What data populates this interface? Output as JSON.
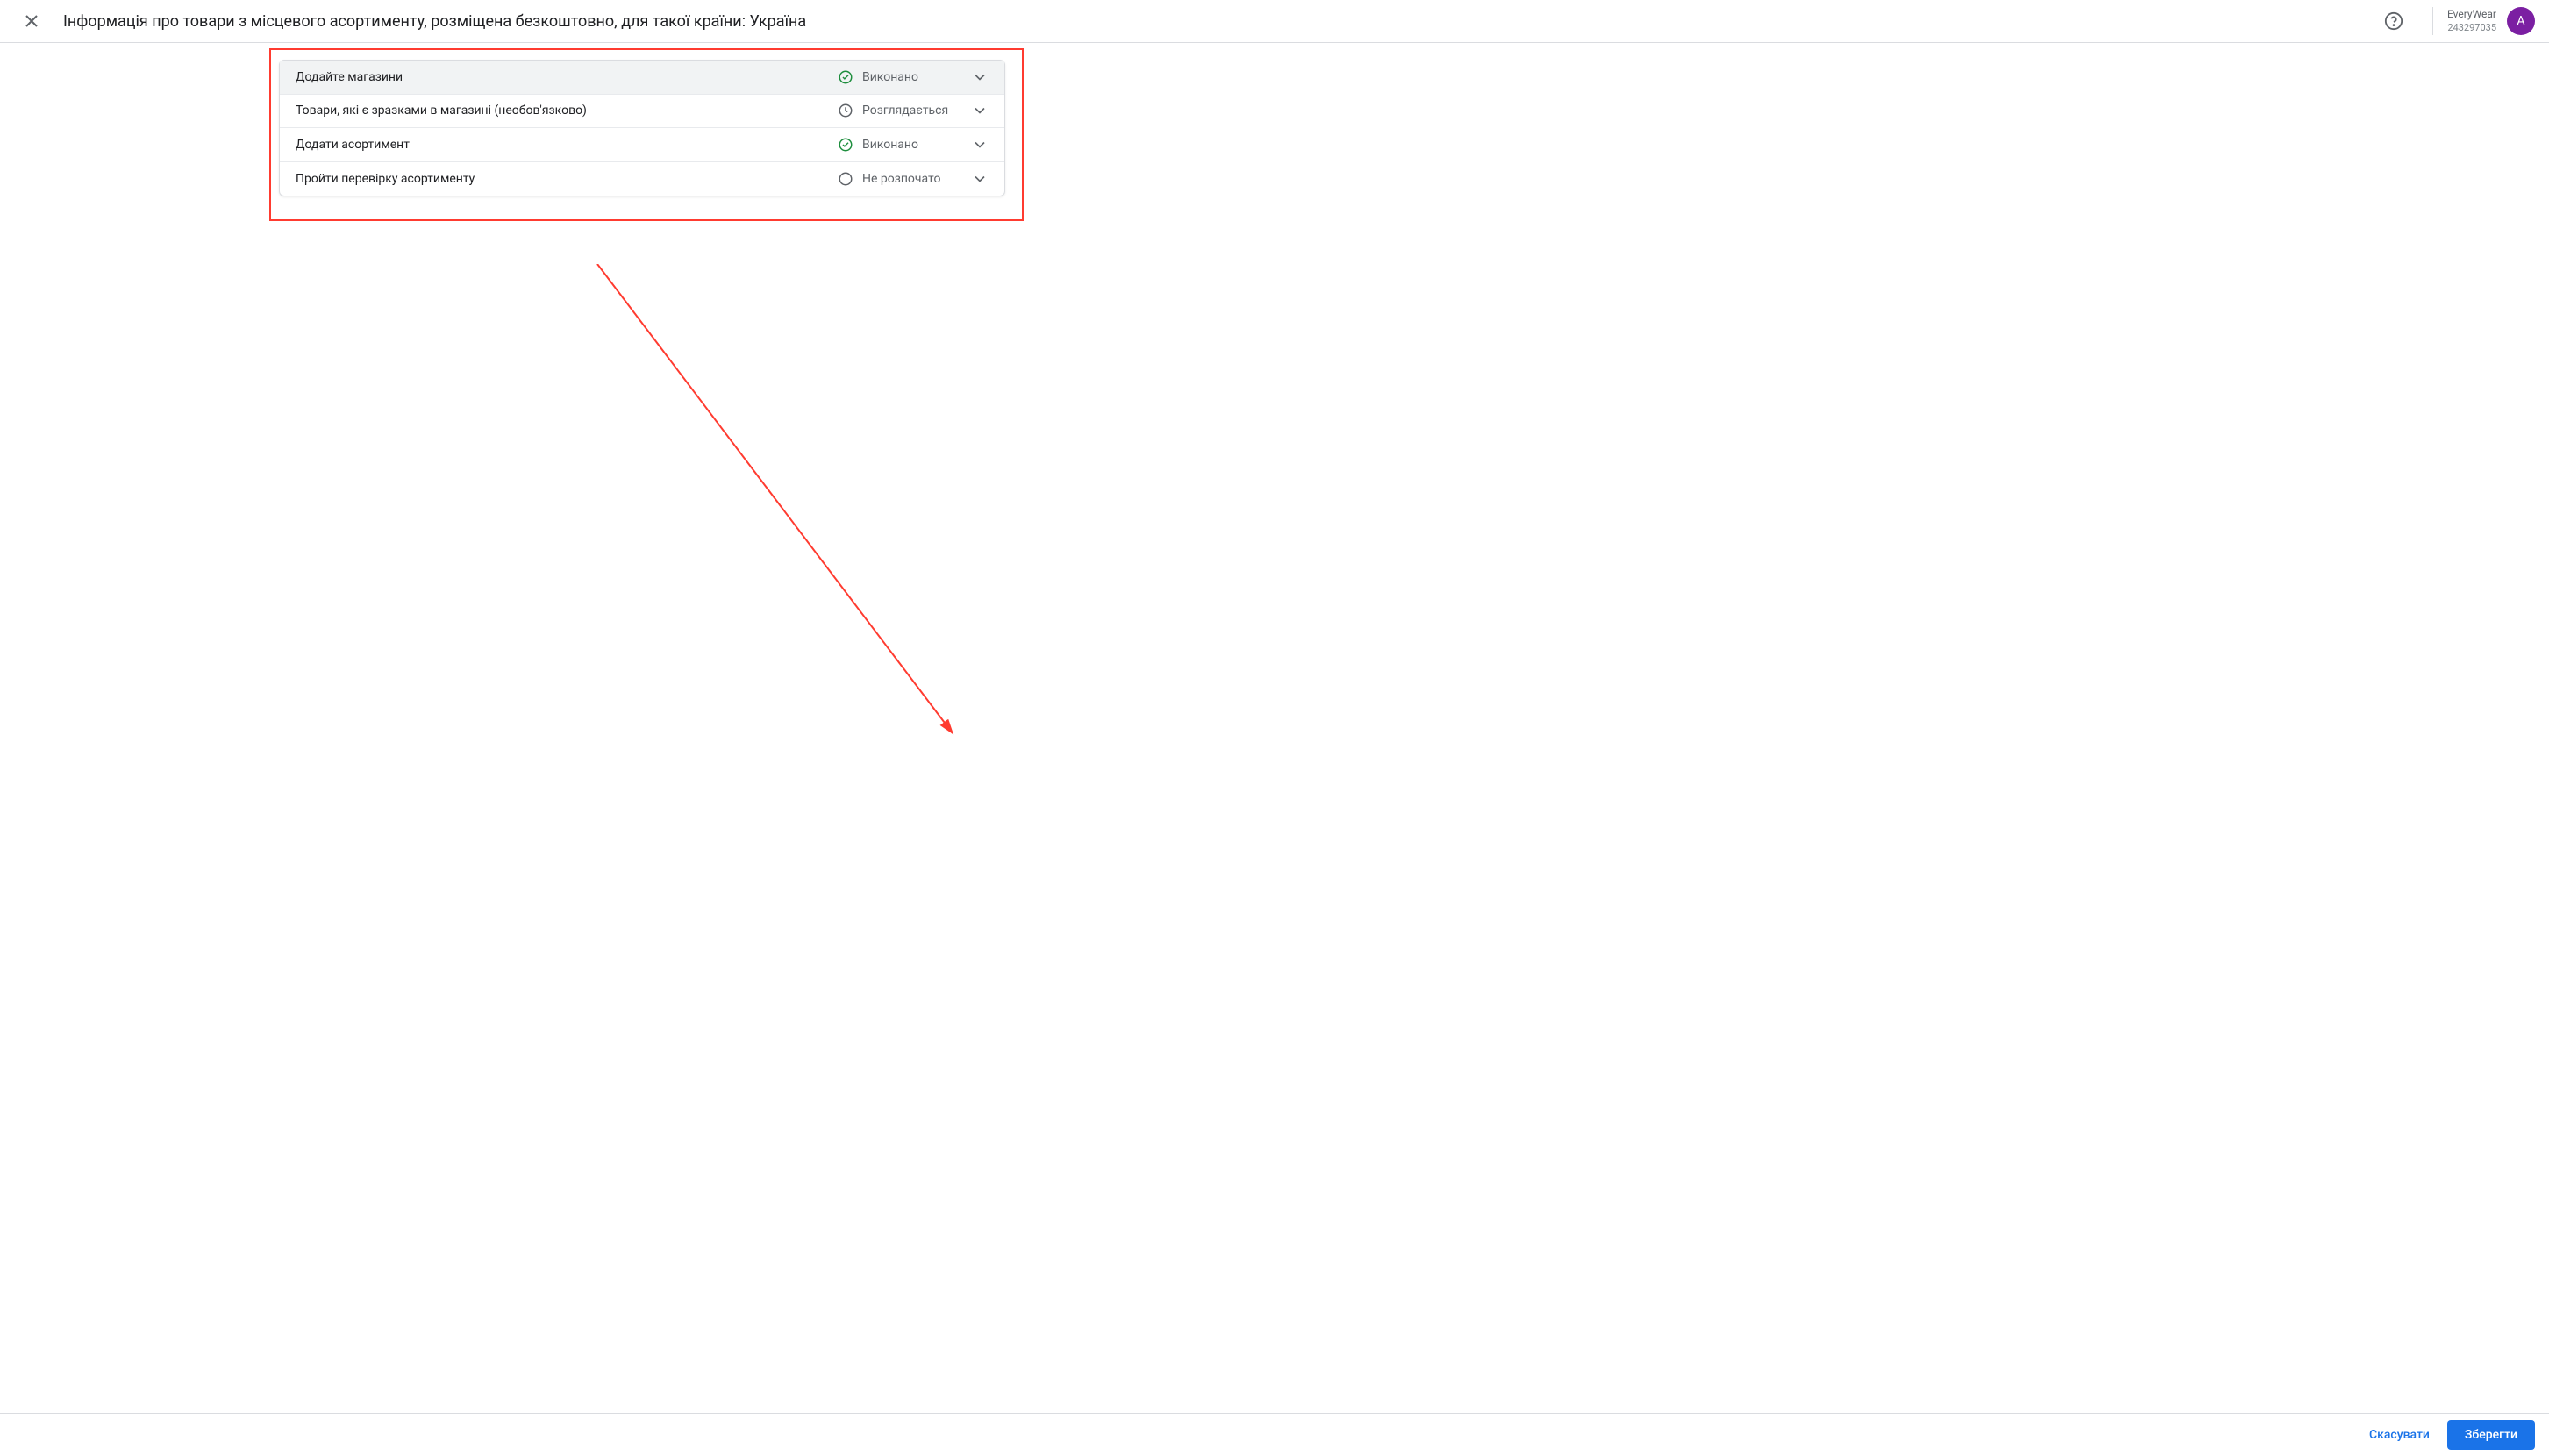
{
  "header": {
    "title": "Інформація про товари з місцевого асортименту, розміщена безкоштовно, для такої країни: Україна",
    "account_name": "EveryWear",
    "account_id": "243297035",
    "avatar_letter": "A"
  },
  "panel": {
    "rows": [
      {
        "label": "Додайте магазини",
        "status": "Виконано",
        "status_type": "done",
        "expanded": true
      },
      {
        "label": "Товари, які є зразками в магазині (необов'язково)",
        "status": "Розглядається",
        "status_type": "pending",
        "expanded": false
      },
      {
        "label": "Додати асортимент",
        "status": "Виконано",
        "status_type": "done",
        "expanded": false
      },
      {
        "label": "Пройти перевірку асортименту",
        "status": "Не розпочато",
        "status_type": "not_started",
        "expanded": false
      }
    ]
  },
  "footer": {
    "cancel": "Скасувати",
    "save": "Зберегти"
  }
}
